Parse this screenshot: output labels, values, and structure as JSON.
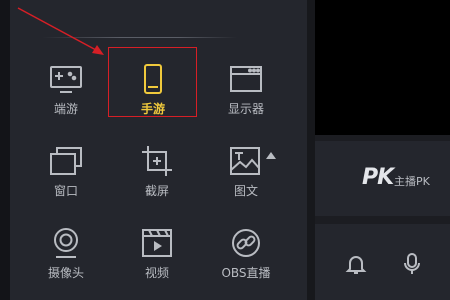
{
  "colors": {
    "accent": "#f0c93c",
    "selection": "#d61f26",
    "text": "#b9bcc2"
  },
  "tiles": [
    {
      "label": "端游",
      "icon": "gamepad-icon"
    },
    {
      "label": "手游",
      "icon": "mobile-icon"
    },
    {
      "label": "显示器",
      "icon": "monitor-icon"
    },
    {
      "label": "窗口",
      "icon": "window-icon"
    },
    {
      "label": "截屏",
      "icon": "screenshot-icon"
    },
    {
      "label": "图文",
      "icon": "image-text-icon"
    },
    {
      "label": "摄像头",
      "icon": "camera-icon"
    },
    {
      "label": "视频",
      "icon": "video-icon"
    },
    {
      "label": "OBS直播",
      "icon": "link-icon"
    }
  ],
  "selected_tile": "手游",
  "pk": {
    "logo": "PK",
    "label": "主播PK"
  },
  "bottom_bar": {
    "icons": [
      "bell-icon",
      "microphone-icon"
    ]
  }
}
